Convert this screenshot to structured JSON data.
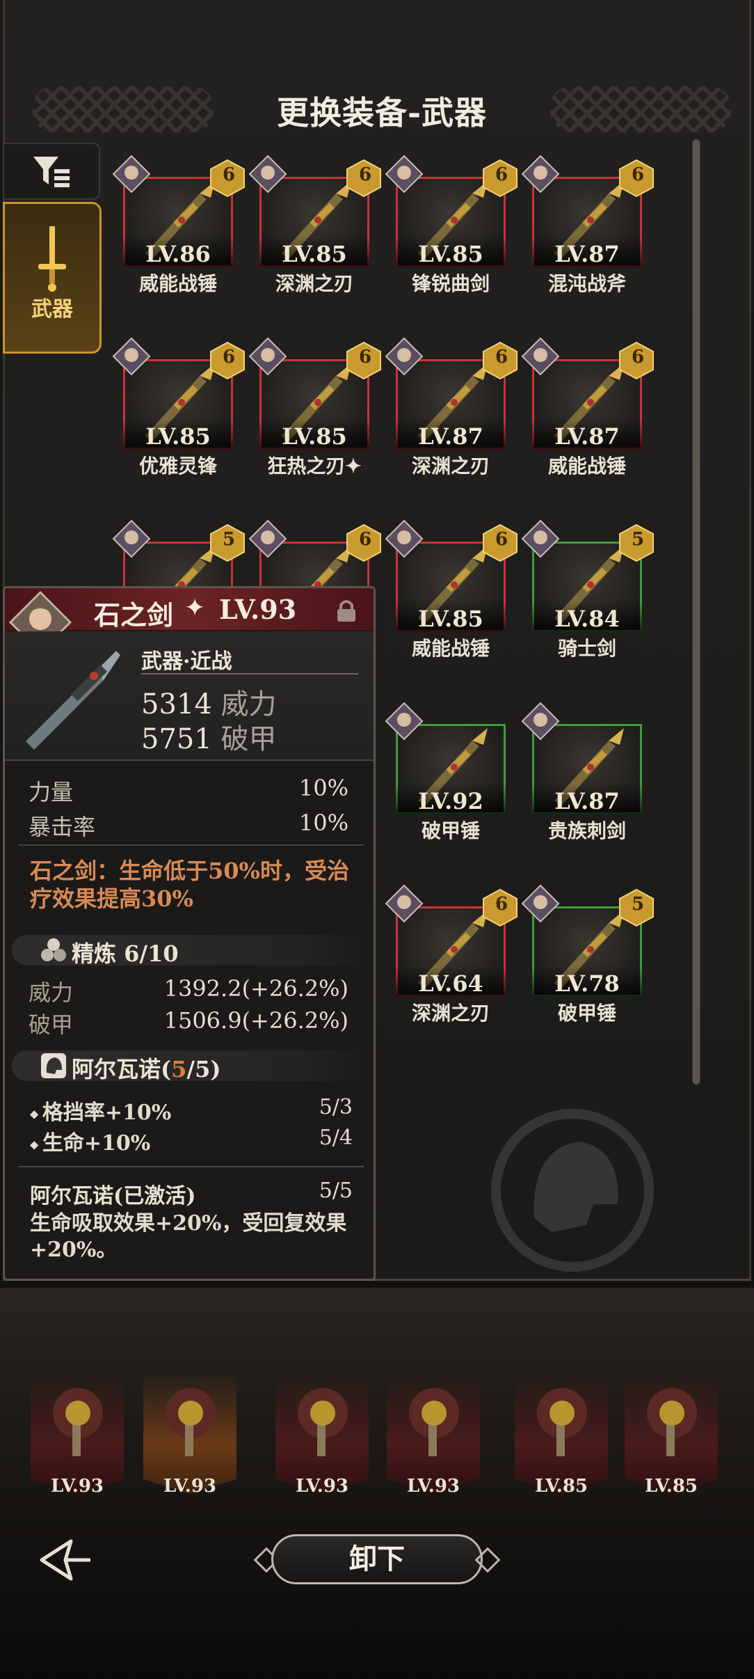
{
  "header": {
    "title": "更换装备-武器"
  },
  "category_tab": {
    "label": "武器",
    "icon": "sword-icon"
  },
  "filter": {
    "icon": "filter-icon"
  },
  "weapons": [
    {
      "level": "LV.86",
      "name": "威能战锤",
      "rank": "6",
      "border": "red"
    },
    {
      "level": "LV.85",
      "name": "深渊之刃",
      "rank": "6",
      "border": "red"
    },
    {
      "level": "LV.85",
      "name": "锋锐曲剑",
      "rank": "6",
      "border": "red"
    },
    {
      "level": "LV.87",
      "name": "混沌战斧",
      "rank": "6",
      "border": "red"
    },
    {
      "level": "LV.85",
      "name": "优雅灵锋",
      "rank": "6",
      "border": "red"
    },
    {
      "level": "LV.85",
      "name": "狂热之刃✦",
      "rank": "6",
      "border": "red"
    },
    {
      "level": "LV.87",
      "name": "深渊之刃",
      "rank": "6",
      "border": "red"
    },
    {
      "level": "LV.87",
      "name": "威能战锤",
      "rank": "6",
      "border": "red"
    },
    {
      "level": "",
      "name": "",
      "rank": "5",
      "border": "red"
    },
    {
      "level": "",
      "name": "",
      "rank": "6",
      "border": "red"
    },
    {
      "level": "LV.85",
      "name": "威能战锤",
      "rank": "6",
      "border": "red"
    },
    {
      "level": "LV.84",
      "name": "骑士剑",
      "rank": "5",
      "border": "green"
    },
    {
      "level": "LV.92",
      "name": "破甲锤",
      "rank": "",
      "border": "green"
    },
    {
      "level": "LV.87",
      "name": "贵族刺剑",
      "rank": "",
      "border": "green"
    },
    {
      "level": "LV.64",
      "name": "深渊之刃",
      "rank": "6",
      "border": "red"
    },
    {
      "level": "LV.78",
      "name": "破甲锤",
      "rank": "5",
      "border": "green"
    }
  ],
  "tooltip": {
    "name": "石之剑",
    "star": "✦",
    "level": "LV.93",
    "type": "武器·近战",
    "power_value": "5314",
    "power_label": "威力",
    "armor_value": "5751",
    "armor_label": "破甲",
    "substats": [
      {
        "label": "力量",
        "value": "10%"
      },
      {
        "label": "暴击率",
        "value": "10%"
      }
    ],
    "passive": "石之剑：生命低于50%时，受治疗效果提高30%",
    "refine": {
      "label": "精炼 6/10",
      "rows": [
        {
          "label": "威力",
          "value": "1392.2(+26.2%)"
        },
        {
          "label": "破甲",
          "value": "1506.9(+26.2%)"
        }
      ]
    },
    "set": {
      "name": "阿尔瓦诺(",
      "count_current": "5",
      "count_total": "/5)",
      "bonuses": [
        {
          "label": "格挡率+10%",
          "value": "5/3"
        },
        {
          "label": "生命+10%",
          "value": "5/4"
        }
      ]
    },
    "set_active": {
      "label": "阿尔瓦诺(已激活)",
      "value": "5/5",
      "desc": "生命吸取效果+20%，受回复效果+20%。"
    }
  },
  "equipped": [
    {
      "level": "LV.93",
      "icon": "hammer-icon"
    },
    {
      "level": "LV.93",
      "icon": "sword-icon"
    },
    {
      "level": "LV.93",
      "icon": "helmet-icon"
    },
    {
      "level": "LV.93",
      "icon": "armor-icon"
    },
    {
      "level": "LV.85",
      "icon": "ring-icon"
    },
    {
      "level": "LV.85",
      "icon": "rapier-icon"
    }
  ],
  "actions": {
    "unequip": "卸下"
  },
  "colors": {
    "rare_border": "#c8333a",
    "common_border": "#3f9c3c",
    "accent_gold": "#c7962e",
    "passive_text": "#d98a55"
  }
}
